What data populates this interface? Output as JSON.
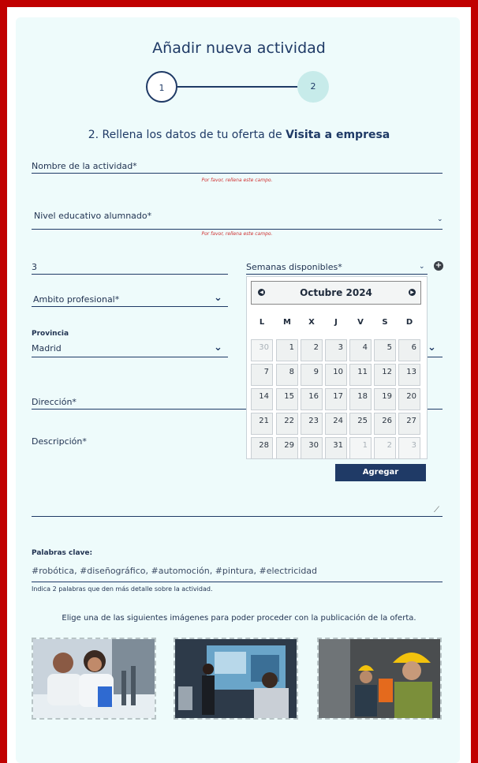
{
  "header": {
    "title": "Añadir nueva actividad",
    "step1": "1",
    "step2": "2",
    "subtitle_prefix": "2. Rellena los datos de tu oferta de ",
    "subtitle_bold": "Visita a empresa"
  },
  "form": {
    "nombre_label": "Nombre de la actividad*",
    "nombre_error": "Por favor, rellena este campo.",
    "nivel_label": "Nivel educativo alumnado*",
    "nivel_error": "Por favor, rellena este campo.",
    "cantidad_value": "3",
    "semanas_label": "Semanas disponibles*",
    "ambito_label": "Ambito profesional*",
    "provincia_label": "Provincia",
    "provincia_value": "Madrid",
    "direccion_label": "Dirección*",
    "descripcion_label": "Descripción*",
    "agregar_button": "Agregar",
    "palabras_label": "Palabras clave:",
    "palabras_placeholder": "#robótica, #diseñográfico, #automoción, #pintura, #electricidad",
    "palabras_hint": "Indica 2 palabras que den más detalle sobre la actividad.",
    "imagenes_instruction": "Elige una de las siguientes imágenes para poder proceder con la publicación de la oferta."
  },
  "calendar": {
    "month": "Octubre 2024",
    "weekdays": [
      "L",
      "M",
      "X",
      "J",
      "V",
      "S",
      "D"
    ],
    "weeks": [
      [
        "30",
        "1",
        "2",
        "3",
        "4",
        "5",
        "6"
      ],
      [
        "7",
        "8",
        "9",
        "10",
        "11",
        "12",
        "13"
      ],
      [
        "14",
        "15",
        "16",
        "17",
        "18",
        "19",
        "20"
      ],
      [
        "21",
        "22",
        "23",
        "24",
        "25",
        "26",
        "27"
      ],
      [
        "28",
        "29",
        "30",
        "31",
        "1",
        "2",
        "3"
      ]
    ],
    "muted": [
      [
        0,
        0
      ],
      [
        4,
        4
      ],
      [
        4,
        5
      ],
      [
        4,
        6
      ]
    ]
  },
  "images": [
    {
      "name": "lab-students"
    },
    {
      "name": "presentation-screen"
    },
    {
      "name": "industrial-workers"
    }
  ],
  "icons": {
    "prev": "◀",
    "next": "▶",
    "plus": "+"
  },
  "colors": {
    "frame": "#c00000",
    "primary": "#1f3a66",
    "error": "#d03030",
    "background": "#eefbfb"
  }
}
